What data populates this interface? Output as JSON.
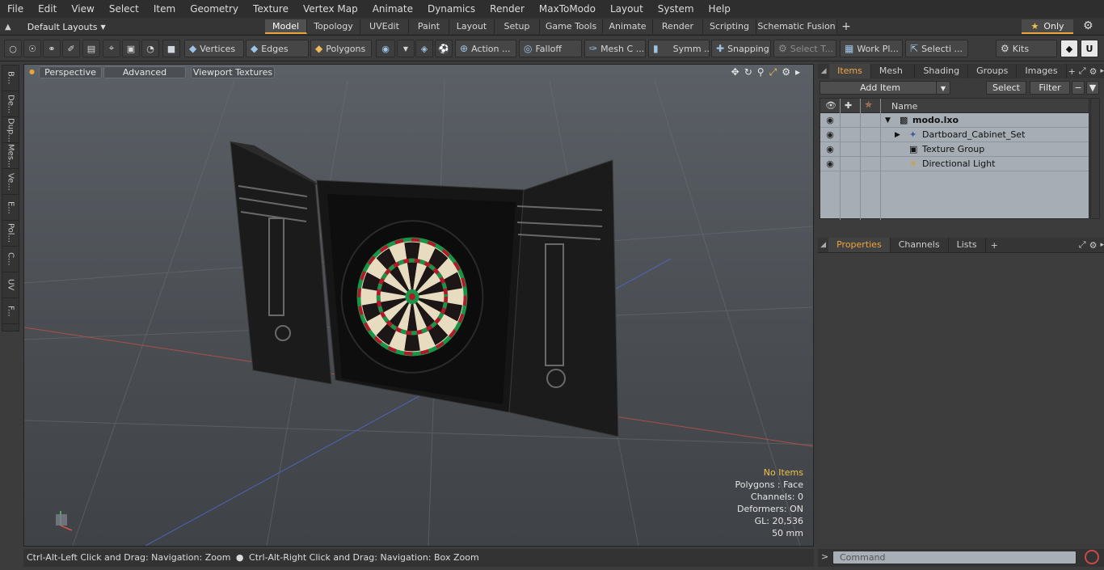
{
  "menu": [
    "File",
    "Edit",
    "View",
    "Select",
    "Item",
    "Geometry",
    "Texture",
    "Vertex Map",
    "Animate",
    "Dynamics",
    "Render",
    "MaxToModo",
    "Layout",
    "System",
    "Help"
  ],
  "layout_select": "Default Layouts",
  "layout_tabs": [
    {
      "label": "Model",
      "active": true
    },
    {
      "label": "Topology"
    },
    {
      "label": "UVEdit"
    },
    {
      "label": "Paint"
    },
    {
      "label": "Layout"
    },
    {
      "label": "Setup"
    },
    {
      "label": "Game Tools"
    },
    {
      "label": "Animate"
    },
    {
      "label": "Render"
    },
    {
      "label": "Scripting"
    },
    {
      "label": "Schematic Fusion"
    }
  ],
  "add_tab": "+",
  "only_label": "Only",
  "toolbar": {
    "vertices": "Vertices",
    "edges": "Edges",
    "polygons": "Polygons",
    "action": "Action ...",
    "falloff": "Falloff",
    "mesh": "Mesh C ...",
    "symm": "Symm ...",
    "snapping": "Snapping",
    "select_t": "Select T...",
    "work_pl": "Work Pl...",
    "selecti": "Selecti ...",
    "kits": "Kits"
  },
  "left_tabs": [
    "B...",
    "De...",
    "Dup...",
    "Mes...",
    "Ve...",
    "E...",
    "Pol...",
    "C...",
    "UV",
    "F..."
  ],
  "viewport": {
    "perspective": "Perspective",
    "advanced": "Advanced",
    "viewport_textures": "Viewport Textures",
    "info": {
      "no_items": "No Items",
      "polygons": "Polygons : Face",
      "channels": "Channels: 0",
      "deformers": "Deformers: ON",
      "gl": "GL: 20,536",
      "scale": "50 mm"
    }
  },
  "status_hint_left": "Ctrl-Alt-Left Click and Drag: Navigation: Zoom",
  "status_hint_right": "Ctrl-Alt-Right Click and Drag: Navigation: Box Zoom",
  "items_panel": {
    "tabs": [
      "Items",
      "Mesh ...",
      "Shading",
      "Groups",
      "Images"
    ],
    "add_item": "Add Item",
    "select": "Select",
    "filter": "Filter",
    "name_header": "Name",
    "rows": [
      {
        "label": "modo.lxo",
        "depth": 0
      },
      {
        "label": "Dartboard_Cabinet_Set",
        "depth": 1
      },
      {
        "label": "Texture Group",
        "depth": 1
      },
      {
        "label": "Directional Light",
        "depth": 1
      }
    ]
  },
  "properties_panel": {
    "tabs": [
      "Properties",
      "Channels",
      "Lists"
    ]
  },
  "command_placeholder": "Command",
  "colors": {
    "accent": "#e8a33b",
    "dart_red": "#b3182a",
    "dart_green": "#1a9447",
    "dart_cream": "#e8dcc0"
  }
}
